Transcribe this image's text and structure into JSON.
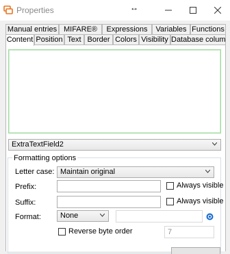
{
  "window": {
    "title": "Properties",
    "cursor_glyph": "↔"
  },
  "tabs_top": [
    {
      "label": "Manual entries"
    },
    {
      "label": "MIFARE®"
    },
    {
      "label": "Expressions"
    },
    {
      "label": "Variables"
    },
    {
      "label": "Functions"
    }
  ],
  "tabs_bottom": [
    {
      "label": "Content",
      "active": true
    },
    {
      "label": "Position"
    },
    {
      "label": "Text"
    },
    {
      "label": "Border"
    },
    {
      "label": "Colors"
    },
    {
      "label": "Visibility"
    },
    {
      "label": "Database columns"
    }
  ],
  "field_select": {
    "value": "ExtraTextField2"
  },
  "formatting": {
    "title": "Formatting options",
    "letter_case_label": "Letter case:",
    "letter_case_value": "Maintain original",
    "prefix_label": "Prefix:",
    "prefix_value": "",
    "suffix_label": "Suffix:",
    "suffix_value": "",
    "always_visible_label": "Always visible",
    "format_label": "Format:",
    "format_value": "None",
    "reverse_byte_order_label": "Reverse byte order",
    "byte_count_value": "7"
  },
  "colors": {
    "accent_green": "#9fd99f",
    "info_blue": "#1e6fd0",
    "app_icon_orange": "#e8731e"
  }
}
